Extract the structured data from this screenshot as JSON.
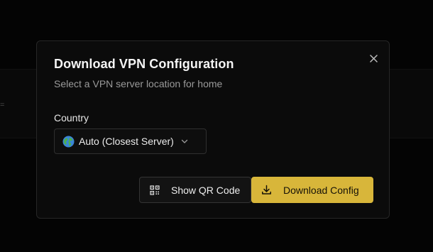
{
  "background": {
    "glyph": "="
  },
  "modal": {
    "title": "Download VPN Configuration",
    "subtitle": "Select a VPN server location for home",
    "close_icon": "close-icon"
  },
  "country": {
    "label": "Country",
    "selected": "Auto (Closest Server)",
    "icon": "globe-icon"
  },
  "actions": {
    "show_qr_label": "Show QR Code",
    "show_qr_icon": "qr-code-icon",
    "download_label": "Download Config",
    "download_icon": "download-icon"
  },
  "colors": {
    "accent": "#d8b63a",
    "background": "#050505",
    "modal_bg": "#0b0b0b"
  }
}
